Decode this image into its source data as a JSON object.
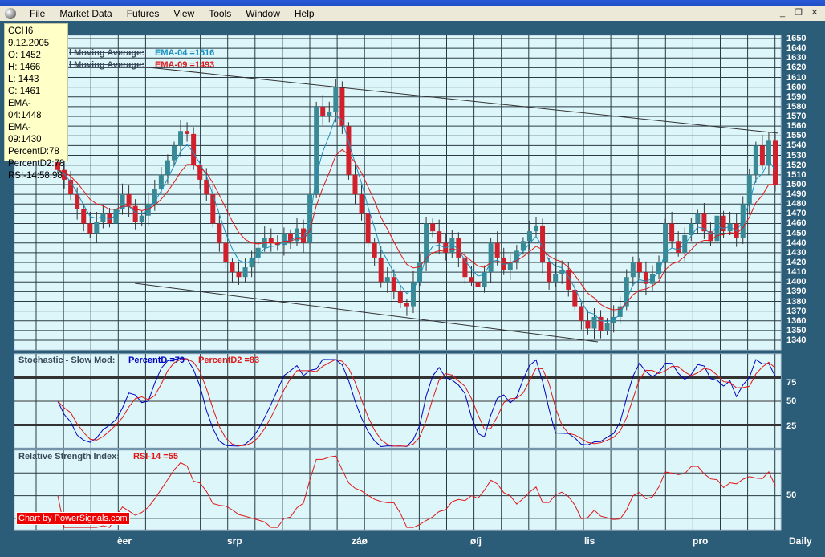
{
  "menu": [
    "File",
    "Market Data",
    "Futures",
    "View",
    "Tools",
    "Window",
    "Help"
  ],
  "window_buttons": [
    "_",
    "❐",
    "✕"
  ],
  "tooltip": [
    "CCH6",
    "9.12.2005",
    "O: 1452",
    "H: 1466",
    "L: 1443",
    "C: 1461",
    "EMA-04:1448",
    "EMA-09:1430",
    "PercentD:78",
    "PercentD2:78",
    "RSI-14:58,98"
  ],
  "legends": {
    "ema1_name": "l Moving Average:",
    "ema1_value": "EMA-04 =1516",
    "ema2_name": "l Moving Average:",
    "ema2_value": "EMA-09 =1493",
    "stoch_name": "Stochastic - Slow Mod:",
    "stoch_d": "PercentD =79",
    "stoch_d2": "PercentD2 =83",
    "rsi_name": "Relative Strength Index:",
    "rsi_value": "RSI-14 =55"
  },
  "watermark": "Chart by PowerSignals.com",
  "colors": {
    "up": "#3a8a96",
    "down": "#d0202c",
    "ema4": "#1a8fbf",
    "ema9": "#e01818",
    "pctd": "#0000c0",
    "pctd2": "#e01818",
    "bg": "#dcf6fa"
  },
  "chart_data": {
    "type": "candlestick",
    "price_ticks": [
      1650,
      1640,
      1630,
      1620,
      1610,
      1600,
      1590,
      1580,
      1570,
      1560,
      1550,
      1540,
      1530,
      1520,
      1510,
      1500,
      1490,
      1480,
      1470,
      1460,
      1450,
      1440,
      1430,
      1420,
      1410,
      1400,
      1390,
      1380,
      1370,
      1360,
      1350,
      1340
    ],
    "stoch_ticks": [
      "75",
      "50",
      "25"
    ],
    "rsi_ticks": [
      "50"
    ],
    "x_labels": [
      "èer",
      "srp",
      "záø",
      "øíj",
      "lis",
      "pro"
    ],
    "period": "Daily",
    "closes": [
      1515,
      1505,
      1490,
      1475,
      1460,
      1450,
      1462,
      1470,
      1460,
      1475,
      1490,
      1478,
      1462,
      1468,
      1480,
      1495,
      1510,
      1525,
      1540,
      1555,
      1552,
      1520,
      1505,
      1490,
      1460,
      1440,
      1420,
      1410,
      1405,
      1415,
      1425,
      1435,
      1445,
      1440,
      1438,
      1450,
      1442,
      1455,
      1440,
      1490,
      1580,
      1570,
      1575,
      1600,
      1560,
      1510,
      1490,
      1470,
      1440,
      1425,
      1400,
      1405,
      1390,
      1378,
      1375,
      1400,
      1420,
      1460,
      1452,
      1440,
      1430,
      1445,
      1425,
      1405,
      1400,
      1395,
      1410,
      1440,
      1425,
      1412,
      1420,
      1432,
      1442,
      1452,
      1458,
      1420,
      1400,
      1408,
      1412,
      1392,
      1375,
      1360,
      1352,
      1364,
      1350,
      1358,
      1364,
      1375,
      1405,
      1420,
      1410,
      1398,
      1408,
      1420,
      1460,
      1442,
      1430,
      1448,
      1460,
      1470,
      1452,
      1442,
      1468,
      1452,
      1460,
      1445,
      1480,
      1510,
      1540,
      1520,
      1545,
      1500
    ]
  }
}
